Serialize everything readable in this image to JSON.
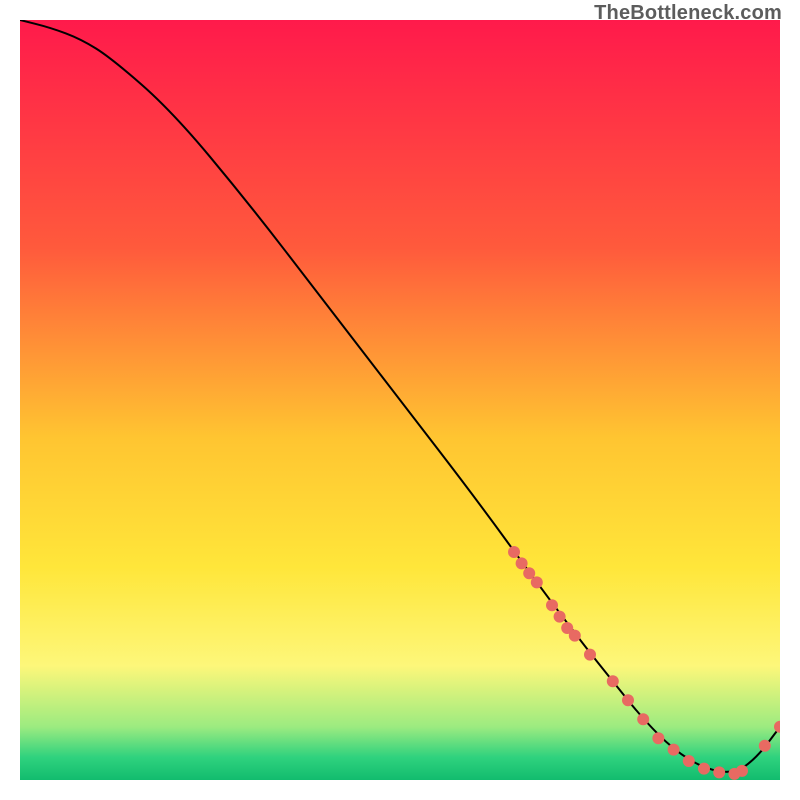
{
  "attribution": "TheBottleneck.com",
  "chart_data": {
    "type": "line",
    "title": "",
    "xlabel": "",
    "ylabel": "",
    "xlim": [
      0,
      100
    ],
    "ylim": [
      0,
      100
    ],
    "grid": false,
    "legend": false,
    "background_gradient": {
      "stops": [
        {
          "offset": 0,
          "color": "#ff1a4b"
        },
        {
          "offset": 0.3,
          "color": "#ff5a3c"
        },
        {
          "offset": 0.55,
          "color": "#ffc531"
        },
        {
          "offset": 0.72,
          "color": "#ffe63a"
        },
        {
          "offset": 0.85,
          "color": "#fdf77a"
        },
        {
          "offset": 0.93,
          "color": "#9ceb80"
        },
        {
          "offset": 0.97,
          "color": "#2fd27e"
        },
        {
          "offset": 1.0,
          "color": "#12bc6e"
        }
      ]
    },
    "series": [
      {
        "name": "bottleneck-curve",
        "x": [
          0,
          4,
          8,
          12,
          20,
          30,
          40,
          50,
          60,
          68,
          74,
          78,
          82,
          86,
          90,
          94,
          97,
          100
        ],
        "y": [
          100,
          99,
          97.5,
          95,
          88,
          76,
          63,
          50,
          37,
          26,
          18,
          13,
          8,
          4,
          1.5,
          0.8,
          3,
          7
        ]
      }
    ],
    "markers": [
      {
        "x": 65,
        "y": 30
      },
      {
        "x": 66,
        "y": 28.5
      },
      {
        "x": 67,
        "y": 27.2
      },
      {
        "x": 68,
        "y": 26
      },
      {
        "x": 70,
        "y": 23
      },
      {
        "x": 71,
        "y": 21.5
      },
      {
        "x": 72,
        "y": 20
      },
      {
        "x": 73,
        "y": 19
      },
      {
        "x": 75,
        "y": 16.5
      },
      {
        "x": 78,
        "y": 13
      },
      {
        "x": 80,
        "y": 10.5
      },
      {
        "x": 82,
        "y": 8.0
      },
      {
        "x": 84,
        "y": 5.5
      },
      {
        "x": 86,
        "y": 4.0
      },
      {
        "x": 88,
        "y": 2.5
      },
      {
        "x": 90,
        "y": 1.5
      },
      {
        "x": 92,
        "y": 1.0
      },
      {
        "x": 94,
        "y": 0.8
      },
      {
        "x": 95,
        "y": 1.2
      },
      {
        "x": 98,
        "y": 4.5
      },
      {
        "x": 100,
        "y": 7.0
      }
    ],
    "marker_style": {
      "fill": "#e86a62",
      "radius": 6
    },
    "line_style": {
      "stroke": "#000000",
      "width": 2
    }
  }
}
